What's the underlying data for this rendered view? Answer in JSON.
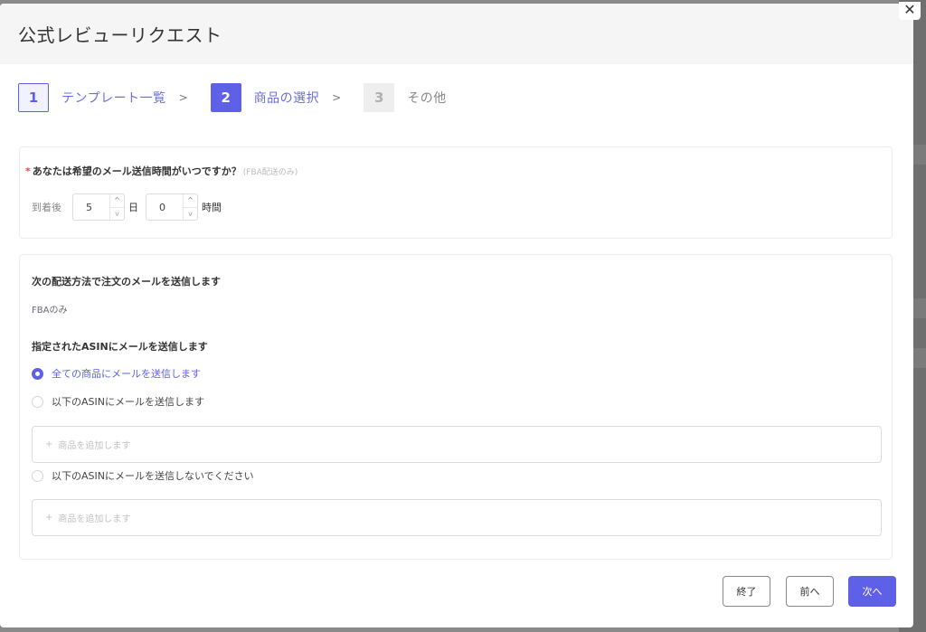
{
  "modal": {
    "title": "公式レビューリクエスト",
    "close_icon": "close-icon"
  },
  "steps": [
    {
      "number": "1",
      "label": "テンプレート一覧",
      "state": "done"
    },
    {
      "number": "2",
      "label": "商品の選択",
      "state": "active"
    },
    {
      "number": "3",
      "label": "その他",
      "state": "pending"
    }
  ],
  "step_separator": ">",
  "timing": {
    "required_mark": "*",
    "question": "あなたは希望のメール送信時間がいつですか？",
    "hint": "(FBA配送のみ)",
    "prefix": "到着後",
    "days_value": "5",
    "days_unit": "日",
    "hours_value": "0",
    "hours_unit": "時間",
    "spin_up": "^",
    "spin_down": "v"
  },
  "shipping": {
    "title": "次の配送方法で注文のメールを送信します",
    "method": "FBAのみ"
  },
  "asin": {
    "title": "指定されたASINにメールを送信します",
    "options": [
      {
        "label": "全ての商品にメールを送信します",
        "selected": true
      },
      {
        "label": "以下のASINにメールを送信します",
        "selected": false
      },
      {
        "label": "以下のASINにメールを送信しないでください",
        "selected": false
      }
    ],
    "add_product_placeholder": "商品を追加します",
    "add_plus": "+"
  },
  "footer": {
    "finish_label": "終了",
    "prev_label": "前へ",
    "next_label": "次へ"
  },
  "colors": {
    "accent": "#5e60e7",
    "required": "#e0474c"
  }
}
